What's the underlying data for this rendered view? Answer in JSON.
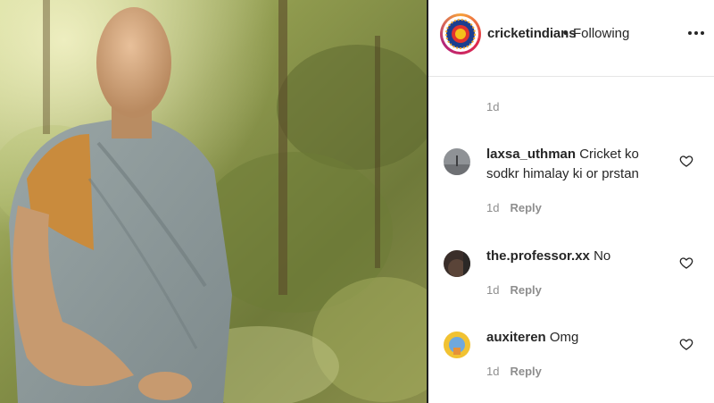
{
  "post": {
    "username": "cricketindians",
    "separator": "•",
    "follow_status": "Following",
    "time_ago": "1d"
  },
  "comments": [
    {
      "username": "laxsa_uthman",
      "text": "Cricket ko sodkr himalay ki or prstan",
      "time": "1d",
      "reply_label": "Reply"
    },
    {
      "username": "the.professor.xx",
      "text": "No",
      "time": "1d",
      "reply_label": "Reply"
    },
    {
      "username": "auxiteren",
      "text": "Omg",
      "time": "1d",
      "reply_label": "Reply"
    }
  ],
  "icons": {
    "more": "more-options-icon",
    "like": "heart-icon"
  },
  "colors": {
    "text": "#262626",
    "secondary": "#8e8e8e",
    "story_ring_start": "#f6a23a",
    "story_ring_end": "#b3257a"
  }
}
